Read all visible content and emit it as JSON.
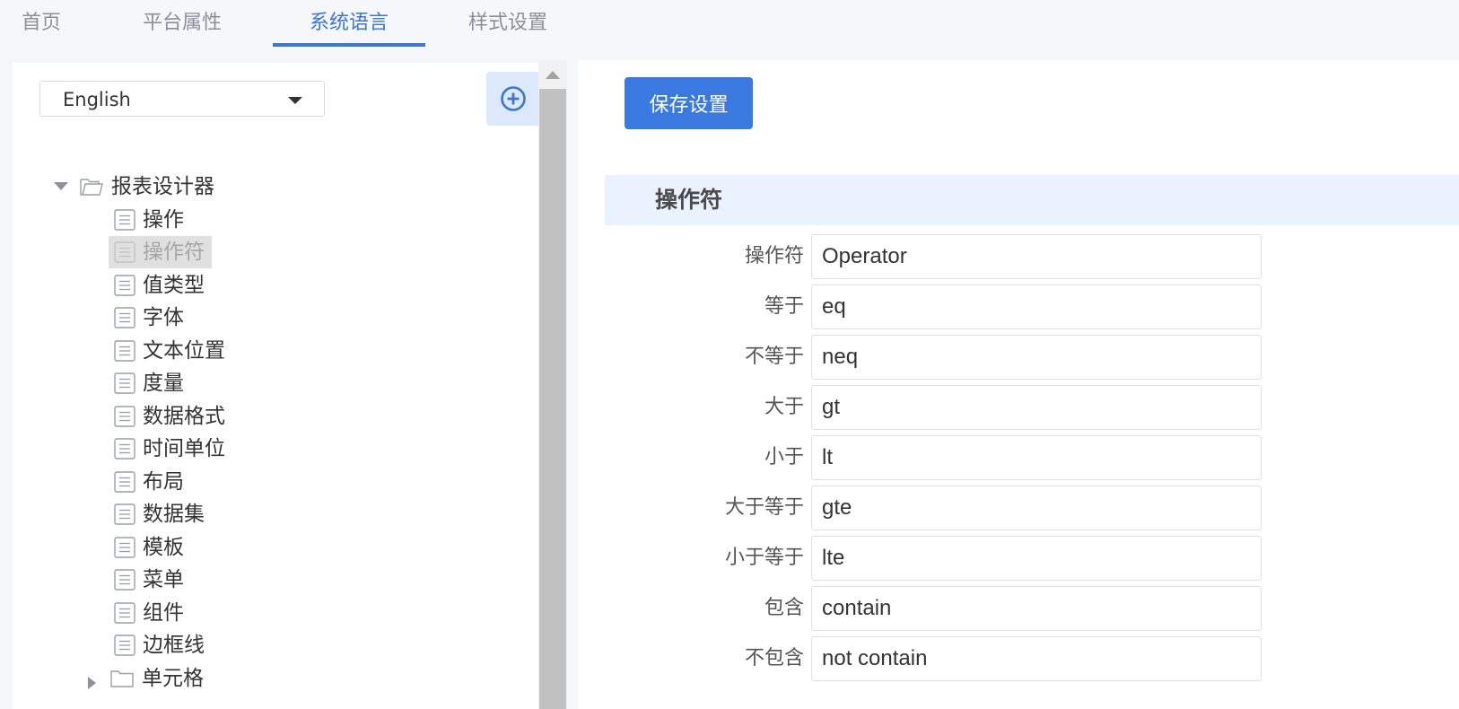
{
  "tabs": [
    {
      "label": "首页",
      "active": false
    },
    {
      "label": "平台属性",
      "active": false
    },
    {
      "label": "系统语言",
      "active": true
    },
    {
      "label": "样式设置",
      "active": false
    }
  ],
  "left_panel": {
    "language_select": {
      "value": "English"
    },
    "add_button": {
      "icon": "plus-circle-icon"
    },
    "tree": {
      "root": {
        "label": "报表设计器",
        "expanded": true
      },
      "items": [
        {
          "label": "操作",
          "selected": false
        },
        {
          "label": "操作符",
          "selected": true
        },
        {
          "label": "值类型",
          "selected": false
        },
        {
          "label": "字体",
          "selected": false
        },
        {
          "label": "文本位置",
          "selected": false
        },
        {
          "label": "度量",
          "selected": false
        },
        {
          "label": "数据格式",
          "selected": false
        },
        {
          "label": "时间单位",
          "selected": false
        },
        {
          "label": "布局",
          "selected": false
        },
        {
          "label": "数据集",
          "selected": false
        },
        {
          "label": "模板",
          "selected": false
        },
        {
          "label": "菜单",
          "selected": false
        },
        {
          "label": "组件",
          "selected": false
        },
        {
          "label": "边框线",
          "selected": false
        }
      ],
      "collapsed_folder": {
        "label": "单元格",
        "expanded": false
      }
    }
  },
  "right_panel": {
    "save_button": {
      "label": "保存设置"
    },
    "section": {
      "title": "操作符"
    },
    "fields": [
      {
        "label": "操作符",
        "value": "Operator"
      },
      {
        "label": "等于",
        "value": "eq"
      },
      {
        "label": "不等于",
        "value": "neq"
      },
      {
        "label": "大于",
        "value": "gt"
      },
      {
        "label": "小于",
        "value": "lt"
      },
      {
        "label": "大于等于",
        "value": "gte"
      },
      {
        "label": "小于等于",
        "value": "lte"
      },
      {
        "label": "包含",
        "value": "contain"
      },
      {
        "label": "不包含",
        "value": "not contain"
      }
    ]
  },
  "colors": {
    "accent": "#3a75d9",
    "button": "#3a7ae0",
    "section_bg": "#eaf2fd",
    "selected_bg": "#e0e0e0"
  }
}
